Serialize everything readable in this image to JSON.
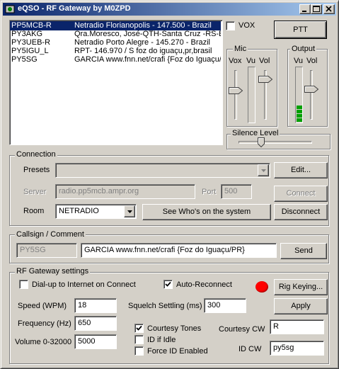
{
  "window": {
    "title": "eQSO - RF Gateway by M0ZPD",
    "controls": [
      "minimize",
      "maximize",
      "close"
    ]
  },
  "station_list": [
    {
      "call": "PP5MCB-R",
      "info": "Netradio Florianopolis - 147.500 - Brazil",
      "selected": true
    },
    {
      "call": "PY3AKG",
      "info": "Qra.Moresco, José-QTH-Santa Cruz -RS-BR",
      "selected": false
    },
    {
      "call": "PY3UEB-R",
      "info": "Netradio Porto Alegre - 145.270 - Brazil",
      "selected": false
    },
    {
      "call": "PY5IGU_L",
      "info": "RPT- 146.970 / S foz do iguaçu,pr,brasil",
      "selected": false
    },
    {
      "call": "PY5SG",
      "info": "GARCIA www.fnn.net/crafi {Foz do Iguaçu/",
      "selected": false
    }
  ],
  "vox": {
    "label": "VOX",
    "checked": false
  },
  "ptt": {
    "label": "PTT"
  },
  "mic": {
    "label": "Mic",
    "vox_label": "Vox",
    "vu_label": "Vu",
    "vol_label": "Vol"
  },
  "output": {
    "label": "Output",
    "vu_label": "Vu",
    "vol_label": "Vol",
    "vu_level": 0.3
  },
  "silence": {
    "label": "Silence Level"
  },
  "connection": {
    "label": "Connection",
    "presets_label": "Presets",
    "presets_value": "",
    "edit_button": "Edit...",
    "server_label": "Server",
    "server_value": "radio.pp5mcb.ampr.org",
    "port_label": "Port",
    "port_value": "500",
    "connect_button": "Connect",
    "room_label": "Room",
    "room_value": "NETRADIO",
    "whos_on_button": "See Who's on the system",
    "disconnect_button": "Disconnect"
  },
  "callsign": {
    "label": "Callsign / Comment",
    "callsign_value": "PY5SG",
    "comment_value": "GARCIA www.fnn.net/crafi {Foz do Iguaçu/PR}",
    "send_button": "Send"
  },
  "rf": {
    "label": "RF Gateway settings",
    "dialup_label": "Dial-up to Internet on Connect",
    "dialup_checked": false,
    "autoreconnect_label": "Auto-Reconnect",
    "autoreconnect_checked": true,
    "status_led_color": "#ff0000",
    "rig_keying_button": "Rig Keying...",
    "speed_label": "Speed (WPM)",
    "speed_value": "18",
    "squelch_label": "Squelch Settling (ms)",
    "squelch_value": "300",
    "apply_button": "Apply",
    "frequency_label": "Frequency (Hz)",
    "frequency_value": "650",
    "volume_label": "Volume 0-32000",
    "volume_value": "5000",
    "courtesy_tones_label": "Courtesy Tones",
    "courtesy_tones_checked": true,
    "id_if_idle_label": "ID if Idle",
    "id_if_idle_checked": false,
    "force_id_label": "Force ID Enabled",
    "force_id_checked": false,
    "courtesy_cw_label": "Courtesy CW",
    "courtesy_cw_value": "R",
    "id_cw_label": "ID CW",
    "id_cw_value": "py5sg"
  }
}
